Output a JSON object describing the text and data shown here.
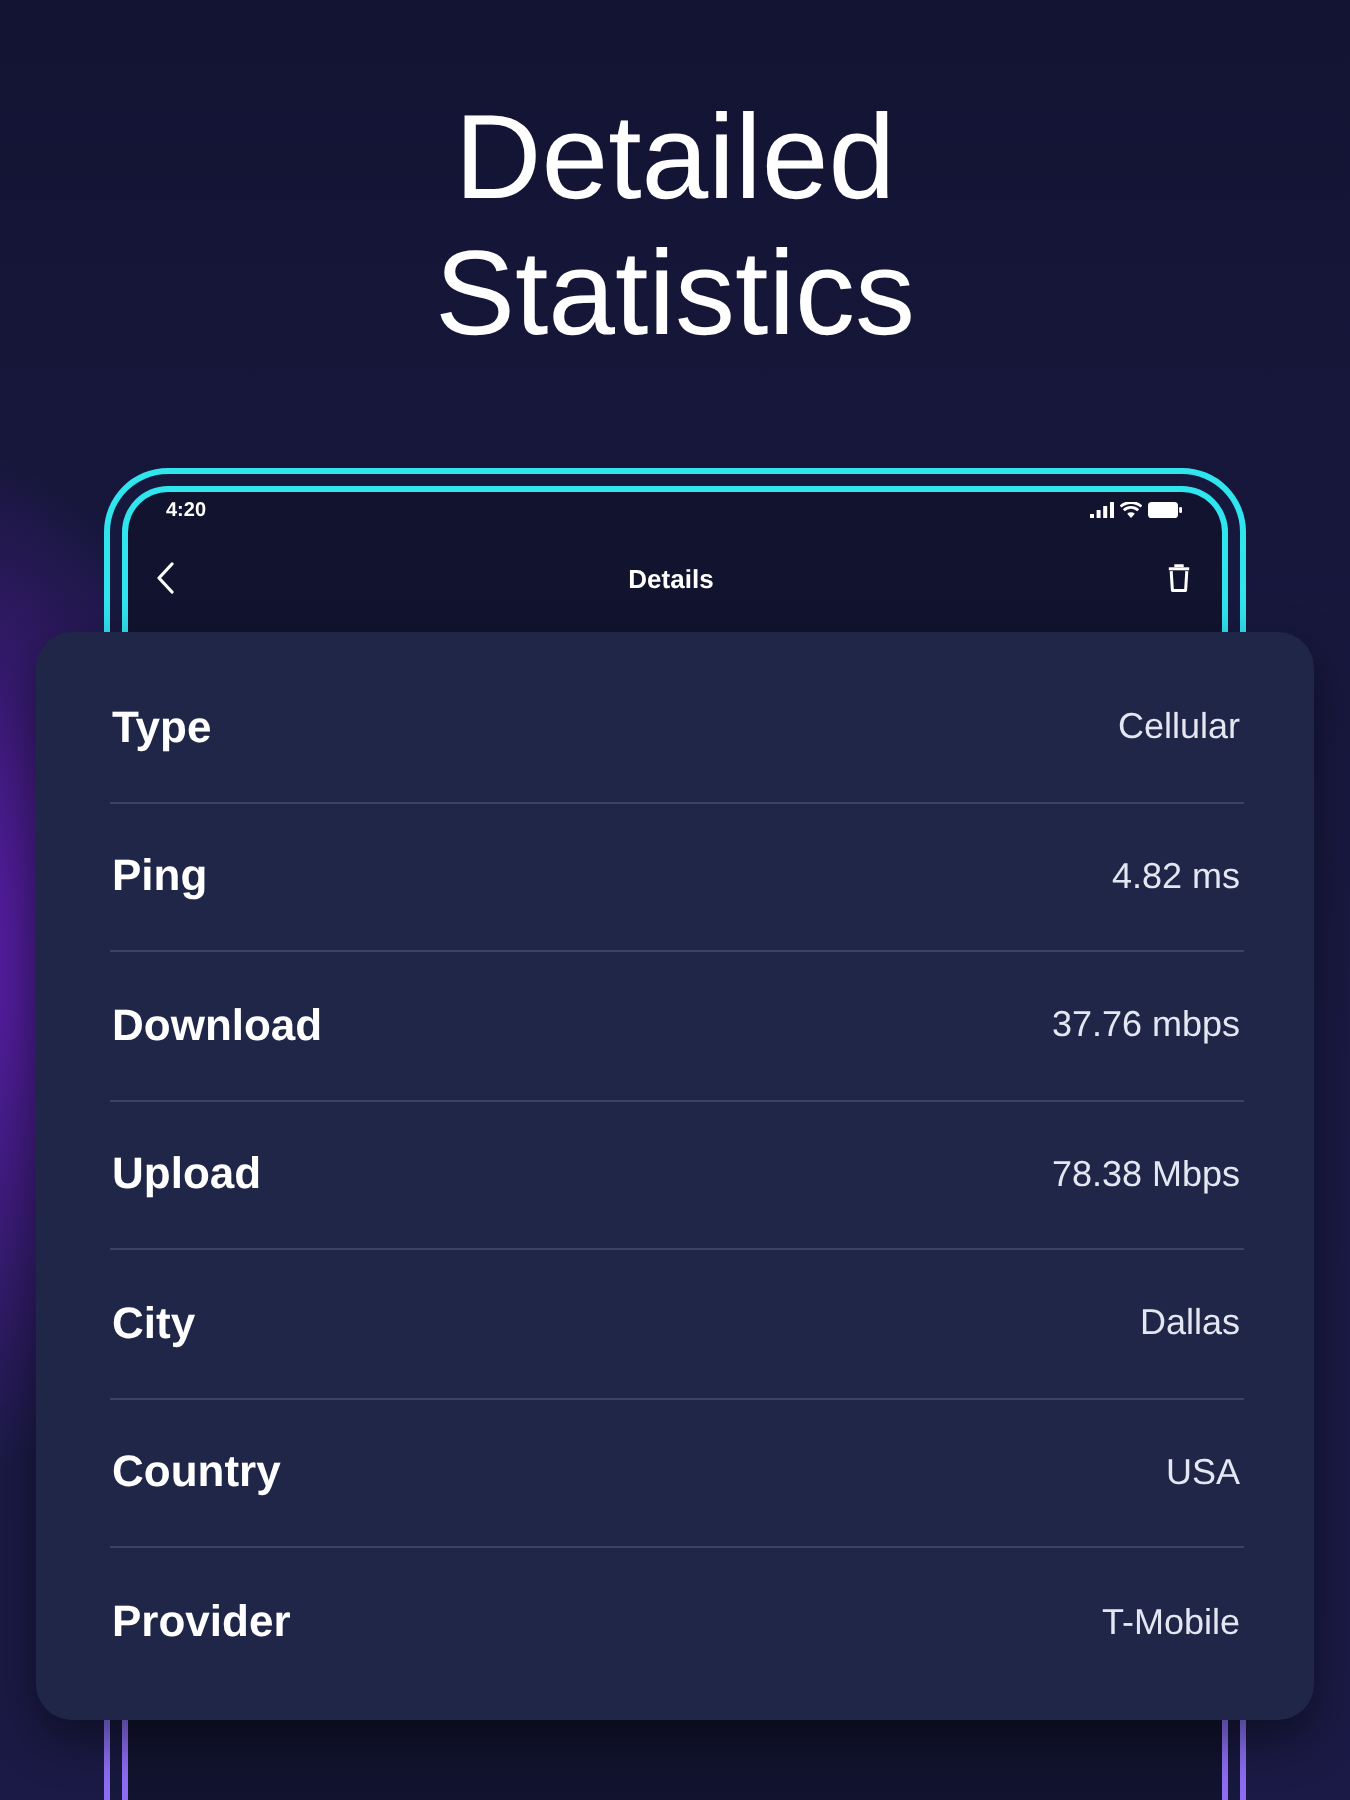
{
  "headline": "Detailed Statistics",
  "phone": {
    "status_bar": {
      "time": "4:20"
    },
    "header": {
      "title": "Details"
    }
  },
  "details": [
    {
      "label": "Type",
      "value": "Cellular"
    },
    {
      "label": "Ping",
      "value": "4.82 ms"
    },
    {
      "label": "Download",
      "value": "37.76 mbps"
    },
    {
      "label": "Upload",
      "value": "78.38 Mbps"
    },
    {
      "label": "City",
      "value": "Dallas"
    },
    {
      "label": "Country",
      "value": "USA"
    },
    {
      "label": "Provider",
      "value": "T-Mobile"
    }
  ]
}
